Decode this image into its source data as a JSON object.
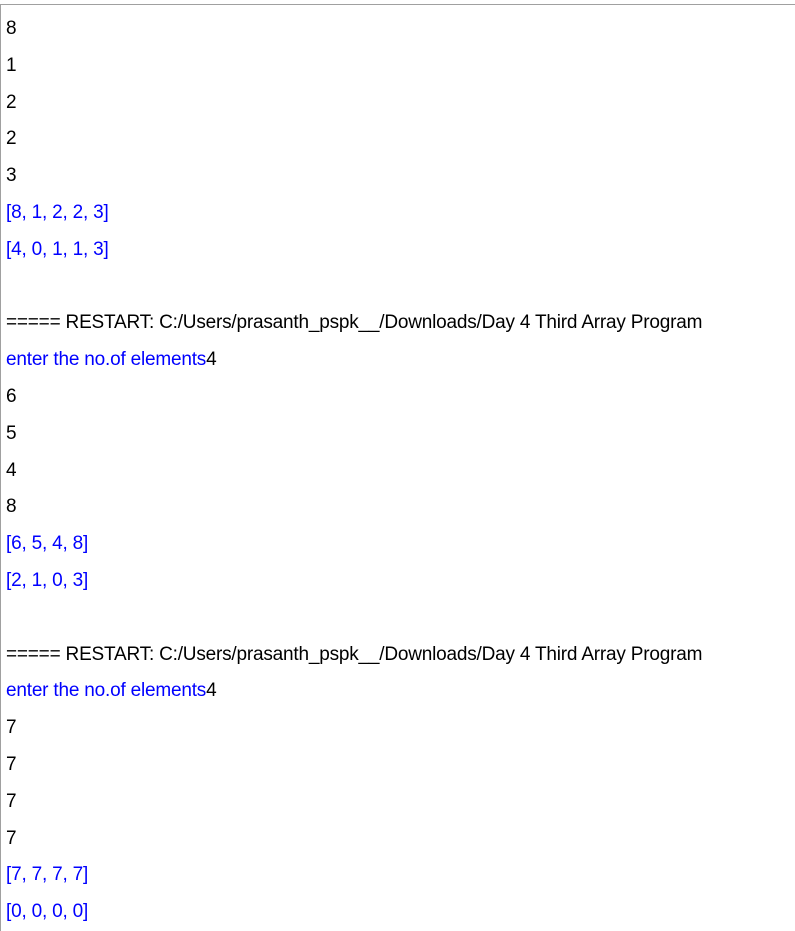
{
  "colors": {
    "input": "#000000",
    "output": "#0000ff",
    "background": "#ffffff"
  },
  "lines": [
    {
      "type": "input",
      "text": "8"
    },
    {
      "type": "input",
      "text": "1"
    },
    {
      "type": "input",
      "text": "2"
    },
    {
      "type": "input",
      "text": "2"
    },
    {
      "type": "input",
      "text": "3"
    },
    {
      "type": "output",
      "text": "[8, 1, 2, 2, 3]"
    },
    {
      "type": "output",
      "text": "[4, 0, 1, 1, 3]"
    },
    {
      "type": "blank",
      "text": ""
    },
    {
      "type": "restart",
      "text": "===== RESTART: C:/Users/prasanth_pspk__/Downloads/Day 4 Third Array Program"
    },
    {
      "type": "prompt",
      "prompt": "enter the no.of elements",
      "value": "4"
    },
    {
      "type": "input",
      "text": "6"
    },
    {
      "type": "input",
      "text": "5"
    },
    {
      "type": "input",
      "text": "4"
    },
    {
      "type": "input",
      "text": "8"
    },
    {
      "type": "output",
      "text": "[6, 5, 4, 8]"
    },
    {
      "type": "output",
      "text": "[2, 1, 0, 3]"
    },
    {
      "type": "blank",
      "text": ""
    },
    {
      "type": "restart",
      "text": "===== RESTART: C:/Users/prasanth_pspk__/Downloads/Day 4 Third Array Program"
    },
    {
      "type": "prompt",
      "prompt": "enter the no.of elements",
      "value": "4"
    },
    {
      "type": "input",
      "text": "7"
    },
    {
      "type": "input",
      "text": "7"
    },
    {
      "type": "input",
      "text": "7"
    },
    {
      "type": "input",
      "text": "7"
    },
    {
      "type": "output",
      "text": "[7, 7, 7, 7]"
    },
    {
      "type": "output",
      "text": "[0, 0, 0, 0]"
    }
  ]
}
